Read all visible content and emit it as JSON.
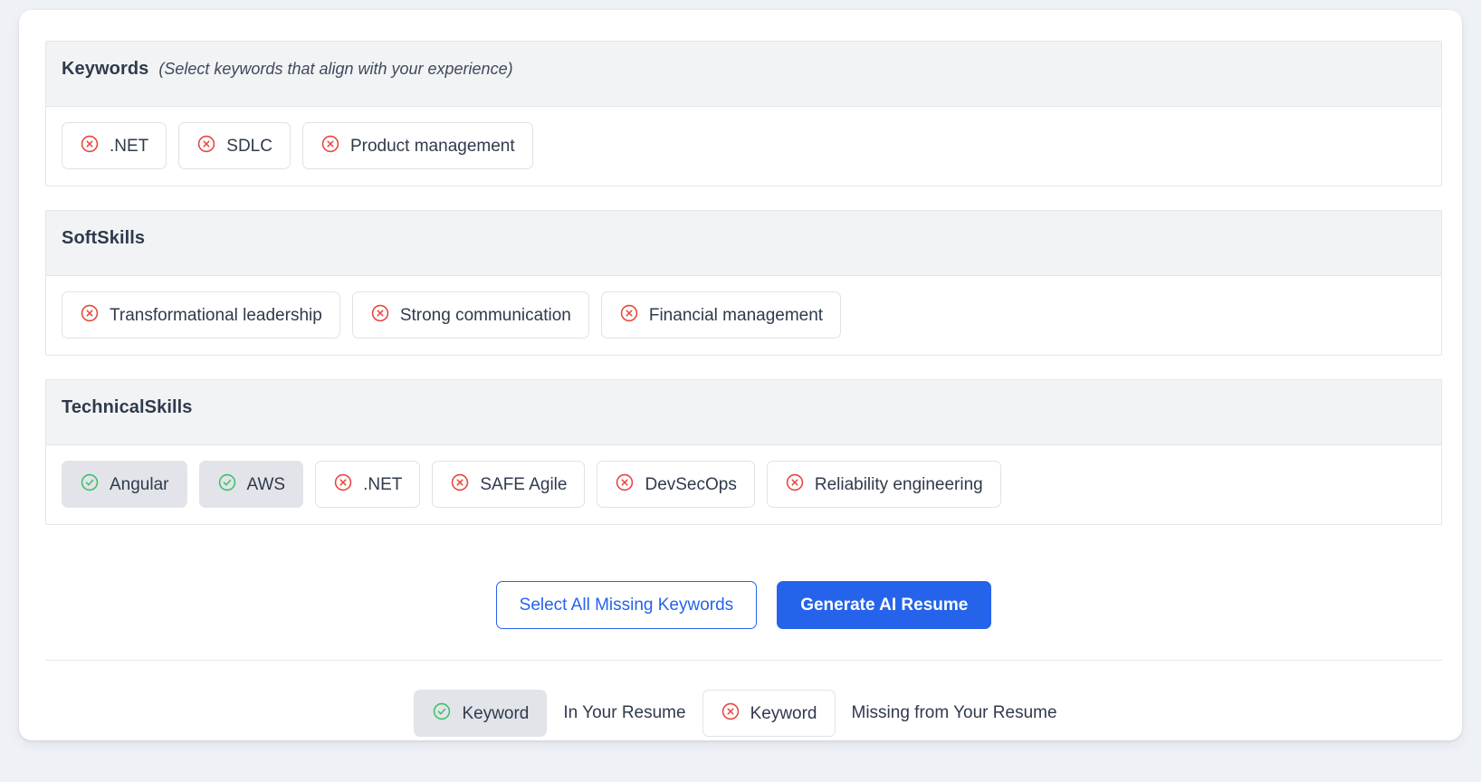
{
  "card": {
    "sections": [
      {
        "id": "keywords",
        "title": "Keywords",
        "note": "(Select keywords that align with your experience)",
        "chips": [
          {
            "label": ".NET",
            "state": "missing",
            "icon": "circle-x-icon"
          },
          {
            "label": "SDLC",
            "state": "missing",
            "icon": "circle-x-icon"
          },
          {
            "label": "Product management",
            "state": "missing",
            "icon": "circle-x-icon"
          }
        ]
      },
      {
        "id": "softskills",
        "title": "SoftSkills",
        "note": "",
        "chips": [
          {
            "label": "Transformational leadership",
            "state": "missing",
            "icon": "circle-x-icon"
          },
          {
            "label": "Strong communication",
            "state": "missing",
            "icon": "circle-x-icon"
          },
          {
            "label": "Financial management",
            "state": "missing",
            "icon": "circle-x-icon"
          }
        ]
      },
      {
        "id": "technicalskills",
        "title": "TechnicalSkills",
        "note": "",
        "chips": [
          {
            "label": "Angular",
            "state": "present",
            "icon": "circle-check-icon"
          },
          {
            "label": "AWS",
            "state": "present",
            "icon": "circle-check-icon"
          },
          {
            "label": ".NET",
            "state": "missing",
            "icon": "circle-x-icon"
          },
          {
            "label": "SAFE Agile",
            "state": "missing",
            "icon": "circle-x-icon"
          },
          {
            "label": "DevSecOps",
            "state": "missing",
            "icon": "circle-x-icon"
          },
          {
            "label": "Reliability engineering",
            "state": "missing",
            "icon": "circle-x-icon"
          }
        ]
      }
    ],
    "actions": {
      "select_all_label": "Select All Missing Keywords",
      "generate_label": "Generate AI Resume"
    },
    "legend": [
      {
        "chip_label": "Keyword",
        "state": "present",
        "icon": "circle-check-icon",
        "description": "In Your Resume"
      },
      {
        "chip_label": "Keyword",
        "state": "missing",
        "icon": "circle-x-icon",
        "description": "Missing from Your Resume"
      }
    ]
  },
  "colors": {
    "page_background": "#eef1f5",
    "card_background": "#ffffff",
    "section_header_background": "#f2f3f5",
    "border": "#e3e6ea",
    "chip_border": "#dfe2e6",
    "chip_selected_background": "#e2e4e9",
    "primary_blue": "#2563eb",
    "missing_red": "#e8453c",
    "present_green": "#3fc06a",
    "text_dark": "#2f3a4c"
  }
}
